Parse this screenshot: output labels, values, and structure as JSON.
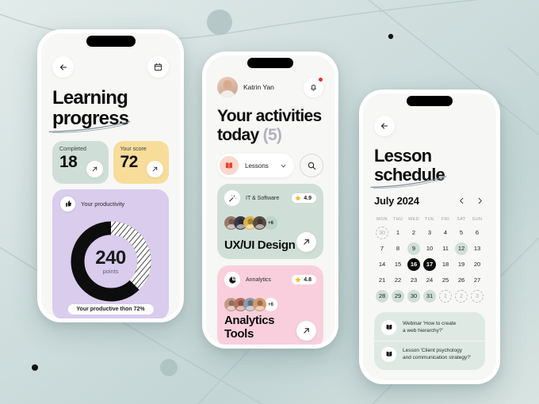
{
  "theme": {
    "bg_gradient_from": "#dfe9e7",
    "bg_gradient_to": "#d6e2e0",
    "mint": "#cfdfd8",
    "gold": "#f8dc9a",
    "lavender": "#d9cced",
    "pink": "#f9cfdd",
    "accent_red": "#e8402a",
    "dark": "#0d0d0d"
  },
  "phone_left": {
    "back_icon": "arrow-left-icon",
    "calendar_icon": "calendar-icon",
    "title_line1": "Learning",
    "title_line2": "progress",
    "stats": [
      {
        "label": "Completed",
        "value": "18",
        "color": "#cfdfd8",
        "action_icon": "arrow-up-right-icon"
      },
      {
        "label": "Your score",
        "value": "72",
        "color": "#f8dc9a",
        "action_icon": "arrow-up-right-icon"
      }
    ],
    "productivity": {
      "icon": "thumbs-up-icon",
      "label": "Your productivity",
      "value": "240",
      "unit": "points",
      "badge": "Your productive thon 72%",
      "card_color": "#d9cced"
    }
  },
  "phone_mid": {
    "user_name": "Katrin Yan",
    "avatar": "user-avatar",
    "bell_icon": "notification-bell-icon",
    "has_notification": true,
    "title_line1": "Your activities",
    "title_line2": "today",
    "count": "(5)",
    "filter": {
      "icon": "book-icon",
      "label": "Lessons",
      "chevron": "chevron-down-icon"
    },
    "search_icon": "search-icon",
    "courses": [
      {
        "category": "IT & Software",
        "category_icon": "magic-wand-icon",
        "rating": "4.9",
        "star_icon": "star-icon",
        "avatar_count": "+6",
        "name": "UX/UI Design",
        "action_icon": "arrow-up-right-icon",
        "color": "#cfdfd8",
        "avatar_colors": [
          "#9a7a6a",
          "#3a3a46",
          "#e0b24a",
          "#5a4a42"
        ]
      },
      {
        "category": "Annalytics",
        "category_icon": "pie-chart-icon",
        "rating": "4.8",
        "star_icon": "star-icon",
        "avatar_count": "+6",
        "name": "Analytics Tools",
        "action_icon": "arrow-up-right-icon",
        "color": "#f9cfdd",
        "avatar_colors": [
          "#c49a86",
          "#b8705e",
          "#8e9aa8",
          "#d69a6c"
        ]
      }
    ]
  },
  "phone_right": {
    "back_icon": "arrow-left-icon",
    "title_line1": "Lesson",
    "title_line2": "schedule",
    "month": "July 2024",
    "prev_icon": "chevron-left-icon",
    "next_icon": "chevron-right-icon",
    "weekdays": [
      "MON",
      "THU",
      "WED",
      "TUE",
      "FRI",
      "SAT",
      "SUN"
    ],
    "weeks": [
      [
        {
          "d": "30",
          "state": "dotted"
        },
        {
          "d": "1",
          "state": "plain"
        },
        {
          "d": "2",
          "state": "plain"
        },
        {
          "d": "3",
          "state": "plain"
        },
        {
          "d": "4",
          "state": "plain"
        },
        {
          "d": "5",
          "state": "plain"
        },
        {
          "d": "6",
          "state": "plain"
        }
      ],
      [
        {
          "d": "7",
          "state": "plain"
        },
        {
          "d": "8",
          "state": "plain"
        },
        {
          "d": "9",
          "state": "mint"
        },
        {
          "d": "10",
          "state": "plain"
        },
        {
          "d": "11",
          "state": "plain"
        },
        {
          "d": "12",
          "state": "mint"
        },
        {
          "d": "13",
          "state": "plain"
        }
      ],
      [
        {
          "d": "14",
          "state": "plain"
        },
        {
          "d": "15",
          "state": "plain"
        },
        {
          "d": "16",
          "state": "dark"
        },
        {
          "d": "17",
          "state": "dark"
        },
        {
          "d": "18",
          "state": "plain"
        },
        {
          "d": "19",
          "state": "plain"
        },
        {
          "d": "20",
          "state": "plain"
        }
      ],
      [
        {
          "d": "21",
          "state": "plain"
        },
        {
          "d": "22",
          "state": "plain"
        },
        {
          "d": "23",
          "state": "plain"
        },
        {
          "d": "24",
          "state": "plain"
        },
        {
          "d": "25",
          "state": "plain"
        },
        {
          "d": "26",
          "state": "plain"
        },
        {
          "d": "27",
          "state": "plain"
        }
      ],
      [
        {
          "d": "28",
          "state": "mint"
        },
        {
          "d": "29",
          "state": "mint"
        },
        {
          "d": "30",
          "state": "mint"
        },
        {
          "d": "31",
          "state": "mint"
        },
        {
          "d": "1",
          "state": "dotted"
        },
        {
          "d": "2",
          "state": "dotted"
        },
        {
          "d": "3",
          "state": "dotted"
        }
      ]
    ],
    "events": [
      {
        "icon": "book-icon",
        "line1": "Webinar 'How to create",
        "line2": "a web hierarchy?'"
      },
      {
        "icon": "book-icon",
        "line1": "Lesson 'Client psychology",
        "line2": "and communication strategy?'"
      }
    ]
  }
}
